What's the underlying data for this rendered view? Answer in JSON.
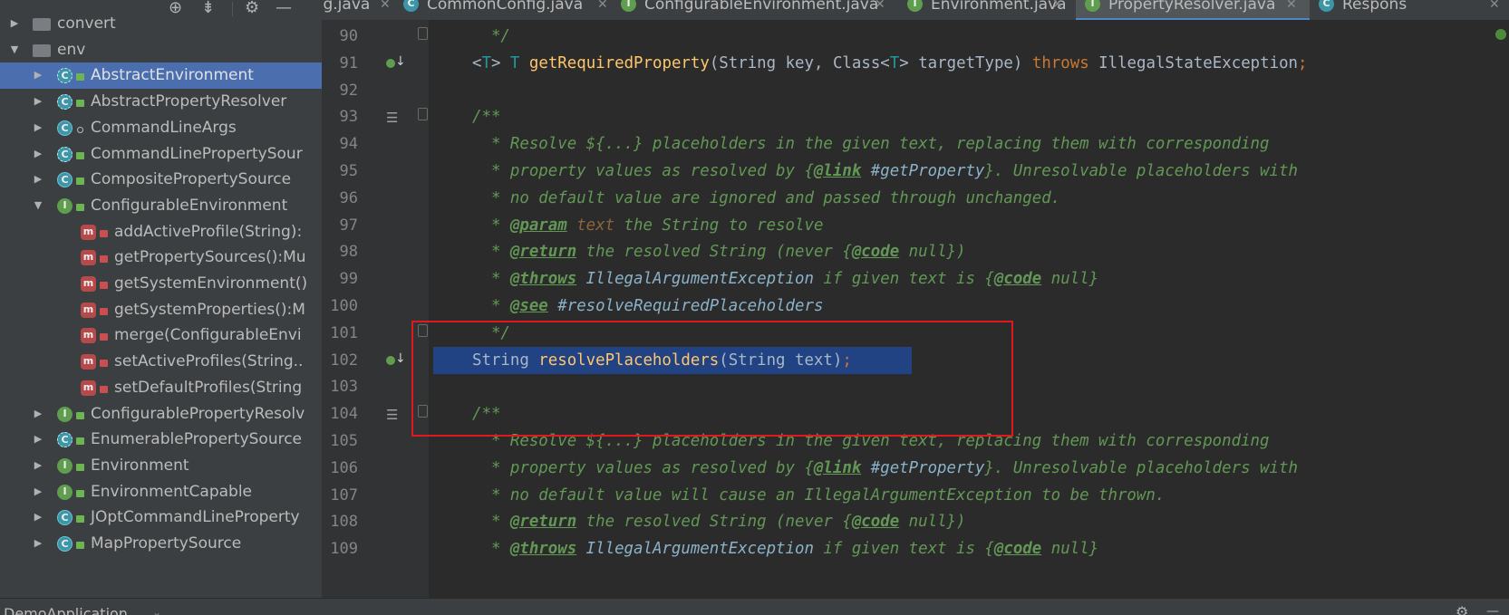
{
  "tree_toolbar": {
    "locate_icon": "⊕",
    "collapse_icon": "⇟",
    "settings_icon": "⚙",
    "hide_icon": "—"
  },
  "tabs": [
    {
      "label": "nfig.java",
      "icon": "",
      "active": false
    },
    {
      "label": "CommonConfig.java",
      "icon": "C",
      "active": false
    },
    {
      "label": "ConfigurableEnvironment.java",
      "icon": "I",
      "active": false
    },
    {
      "label": "Environment.java",
      "icon": "I",
      "active": false
    },
    {
      "label": "PropertyResolver.java",
      "icon": "I",
      "active": true
    },
    {
      "label": "Respons",
      "icon": "C",
      "active": false
    }
  ],
  "tree": [
    {
      "label": "convert",
      "kind": "folder",
      "expanded": false,
      "depth": 0
    },
    {
      "label": "env",
      "kind": "folder",
      "expanded": true,
      "depth": 0
    },
    {
      "label": "AbstractEnvironment",
      "kind": "abstract",
      "expanded": false,
      "depth": 1,
      "selected": true
    },
    {
      "label": "AbstractPropertyResolver",
      "kind": "abstract",
      "expanded": false,
      "depth": 1
    },
    {
      "label": "CommandLineArgs",
      "kind": "class-pkg",
      "expanded": false,
      "depth": 1
    },
    {
      "label": "CommandLinePropertySour",
      "kind": "abstract",
      "expanded": false,
      "depth": 1
    },
    {
      "label": "CompositePropertySource",
      "kind": "class",
      "expanded": false,
      "depth": 1
    },
    {
      "label": "ConfigurableEnvironment",
      "kind": "interface",
      "expanded": true,
      "depth": 1
    },
    {
      "label": "addActiveProfile(String):",
      "kind": "method",
      "depth": 2
    },
    {
      "label": "getPropertySources():Mu",
      "kind": "method",
      "depth": 2
    },
    {
      "label": "getSystemEnvironment()",
      "kind": "method",
      "depth": 2
    },
    {
      "label": "getSystemProperties():M",
      "kind": "method",
      "depth": 2
    },
    {
      "label": "merge(ConfigurableEnvi",
      "kind": "method",
      "depth": 2
    },
    {
      "label": "setActiveProfiles(String..",
      "kind": "method",
      "depth": 2
    },
    {
      "label": "setDefaultProfiles(String",
      "kind": "method",
      "depth": 2
    },
    {
      "label": "ConfigurablePropertyResolv",
      "kind": "interface",
      "expanded": false,
      "depth": 1
    },
    {
      "label": "EnumerablePropertySource",
      "kind": "abstract",
      "expanded": false,
      "depth": 1
    },
    {
      "label": "Environment",
      "kind": "interface",
      "expanded": false,
      "depth": 1
    },
    {
      "label": "EnvironmentCapable",
      "kind": "interface",
      "expanded": false,
      "depth": 1
    },
    {
      "label": "JOptCommandLineProperty",
      "kind": "class",
      "expanded": false,
      "depth": 1
    },
    {
      "label": "MapPropertySource",
      "kind": "class",
      "expanded": false,
      "depth": 1
    }
  ],
  "gutter": {
    "91": "impl",
    "93": "doc",
    "102": "impl",
    "104": "doc"
  },
  "code_lines": [
    {
      "n": "90",
      "fold": true,
      "tokens": [
        [
          "doc",
          "  */"
        ]
      ]
    },
    {
      "n": "91",
      "fold": false,
      "tokens": [
        [
          "type",
          "<"
        ],
        [
          "gen",
          "T"
        ],
        [
          "type",
          "> "
        ],
        [
          "gen",
          "T"
        ],
        [
          "type",
          " "
        ],
        [
          "fn",
          "getRequiredProperty"
        ],
        [
          "type",
          "(String key, Class<"
        ],
        [
          "gen",
          "T"
        ],
        [
          "type",
          "> targetType) "
        ],
        [
          "kw",
          "throws"
        ],
        [
          "type",
          " IllegalStateException"
        ],
        [
          "kw",
          ";"
        ]
      ]
    },
    {
      "n": "92",
      "fold": false,
      "tokens": []
    },
    {
      "n": "93",
      "fold": true,
      "tokens": [
        [
          "doc",
          "/**"
        ]
      ]
    },
    {
      "n": "94",
      "fold": false,
      "tokens": [
        [
          "doc",
          "  * Resolve ${...} placeholders in the given text, replacing them with corresponding"
        ]
      ]
    },
    {
      "n": "95",
      "fold": false,
      "tokens": [
        [
          "doc",
          "  * property values as resolved by {"
        ],
        [
          "tag",
          "@link"
        ],
        [
          "ref",
          " #getProperty"
        ],
        [
          "doc",
          "}. Unresolvable placeholders with"
        ]
      ]
    },
    {
      "n": "96",
      "fold": false,
      "tokens": [
        [
          "doc",
          "  * no default value are ignored and passed through unchanged."
        ]
      ]
    },
    {
      "n": "97",
      "fold": false,
      "tokens": [
        [
          "doc",
          "  * "
        ],
        [
          "tag",
          "@param"
        ],
        [
          "pname",
          " text"
        ],
        [
          "doc",
          " the String to resolve"
        ]
      ]
    },
    {
      "n": "98",
      "fold": false,
      "tokens": [
        [
          "doc",
          "  * "
        ],
        [
          "tag",
          "@return"
        ],
        [
          "doc",
          " the resolved String (never {"
        ],
        [
          "tag",
          "@code"
        ],
        [
          "doc",
          " null})"
        ]
      ]
    },
    {
      "n": "99",
      "fold": false,
      "tokens": [
        [
          "doc",
          "  * "
        ],
        [
          "tag",
          "@throws"
        ],
        [
          "ref",
          " IllegalArgumentException"
        ],
        [
          "doc",
          " if given text is {"
        ],
        [
          "tag",
          "@code"
        ],
        [
          "doc",
          " null}"
        ]
      ]
    },
    {
      "n": "100",
      "fold": false,
      "tokens": [
        [
          "doc",
          "  * "
        ],
        [
          "tag",
          "@see"
        ],
        [
          "ref",
          " #resolveRequiredPlaceholders"
        ]
      ]
    },
    {
      "n": "101",
      "fold": true,
      "tokens": [
        [
          "doc",
          "  */"
        ]
      ]
    },
    {
      "n": "102",
      "fold": false,
      "selected": true,
      "tokens": [
        [
          "type",
          "String "
        ],
        [
          "fn",
          "resolvePlaceholders"
        ],
        [
          "type",
          "(String text)"
        ],
        [
          "kw",
          ";"
        ]
      ]
    },
    {
      "n": "103",
      "fold": false,
      "tokens": []
    },
    {
      "n": "104",
      "fold": true,
      "tokens": [
        [
          "doc",
          "/**"
        ]
      ]
    },
    {
      "n": "105",
      "fold": false,
      "tokens": [
        [
          "doc",
          "  * Resolve ${...} placeholders in the given text, replacing them with corresponding"
        ]
      ]
    },
    {
      "n": "106",
      "fold": false,
      "tokens": [
        [
          "doc",
          "  * property values as resolved by {"
        ],
        [
          "tag",
          "@link"
        ],
        [
          "ref",
          " #getProperty"
        ],
        [
          "doc",
          "}. Unresolvable placeholders with"
        ]
      ]
    },
    {
      "n": "107",
      "fold": false,
      "tokens": [
        [
          "doc",
          "  * no default value will cause an IllegalArgumentException to be thrown."
        ]
      ]
    },
    {
      "n": "108",
      "fold": false,
      "tokens": [
        [
          "doc",
          "  * "
        ],
        [
          "tag",
          "@return"
        ],
        [
          "doc",
          " the resolved String (never {"
        ],
        [
          "tag",
          "@code"
        ],
        [
          "doc",
          " null})"
        ]
      ]
    },
    {
      "n": "109",
      "fold": false,
      "tokens": [
        [
          "doc",
          "  * "
        ],
        [
          "tag",
          "@throws"
        ],
        [
          "ref",
          " IllegalArgumentException"
        ],
        [
          "doc",
          " if given text is {"
        ],
        [
          "tag",
          "@code"
        ],
        [
          "doc",
          " null}"
        ]
      ]
    }
  ],
  "bottom": {
    "run_config": "DemoApplication",
    "chevron": "⌄",
    "gear": "⚙",
    "collapse": "—"
  },
  "colors": {
    "accent": "#4b6eaf",
    "selection": "#214283",
    "highlight_box": "#e0191e"
  }
}
